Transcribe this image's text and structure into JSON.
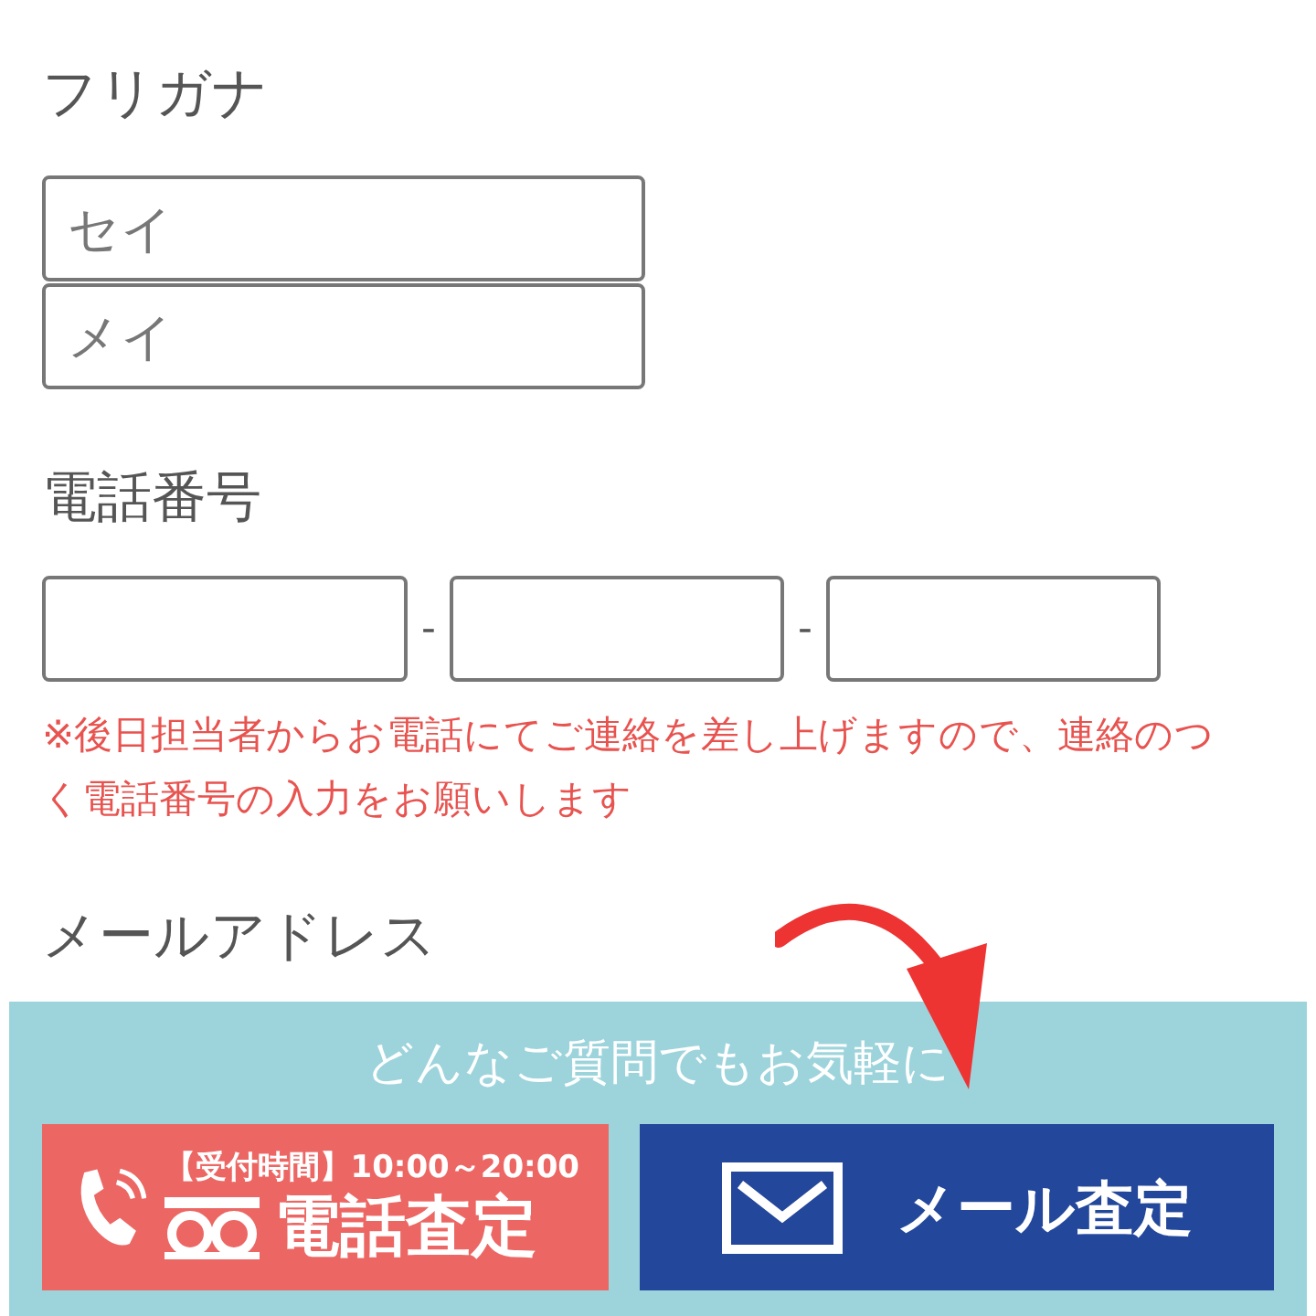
{
  "furigana": {
    "label": "フリガナ",
    "fields": [
      {
        "placeholder": "セイ"
      },
      {
        "placeholder": "メイ"
      }
    ]
  },
  "phone": {
    "label": "電話番号",
    "fields": [
      {
        "kind": "area_code"
      },
      {
        "kind": "exchange"
      },
      {
        "kind": "subscriber"
      }
    ],
    "separators": [
      "-",
      "-"
    ],
    "note": "※後日担当者からお電話にてご連絡を差し上げますので、連絡のつく電話番号の入力をお願いします"
  },
  "email": {
    "label": "メールアドレス"
  },
  "banner": {
    "message": "どんなご質問でもお気軽に",
    "phone_button": {
      "hours": "【受付時間】10:00～20:00",
      "label": "電話査定"
    },
    "mail_button": {
      "label": "メール査定"
    }
  }
}
